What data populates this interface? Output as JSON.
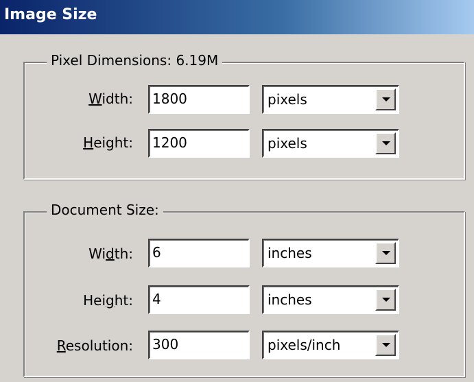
{
  "window": {
    "title": "Image Size"
  },
  "pixel_dimensions": {
    "legend": "Pixel Dimensions:  6.19M",
    "width": {
      "label_pre": "",
      "label_key": "W",
      "label_post": "idth:",
      "value": "1800",
      "unit": "pixels"
    },
    "height": {
      "label_pre": "",
      "label_key": "H",
      "label_post": "eight:",
      "value": "1200",
      "unit": "pixels"
    }
  },
  "document_size": {
    "legend": "Document Size:",
    "width": {
      "label_pre": "Wi",
      "label_key": "d",
      "label_post": "th:",
      "value": "6",
      "unit": "inches"
    },
    "height": {
      "label_pre": "Hei",
      "label_key": "g",
      "label_post": "ht:",
      "value": "4",
      "unit": "inches"
    },
    "resolution": {
      "label_pre": "",
      "label_key": "R",
      "label_post": "esolution:",
      "value": "300",
      "unit": "pixels/inch"
    }
  }
}
